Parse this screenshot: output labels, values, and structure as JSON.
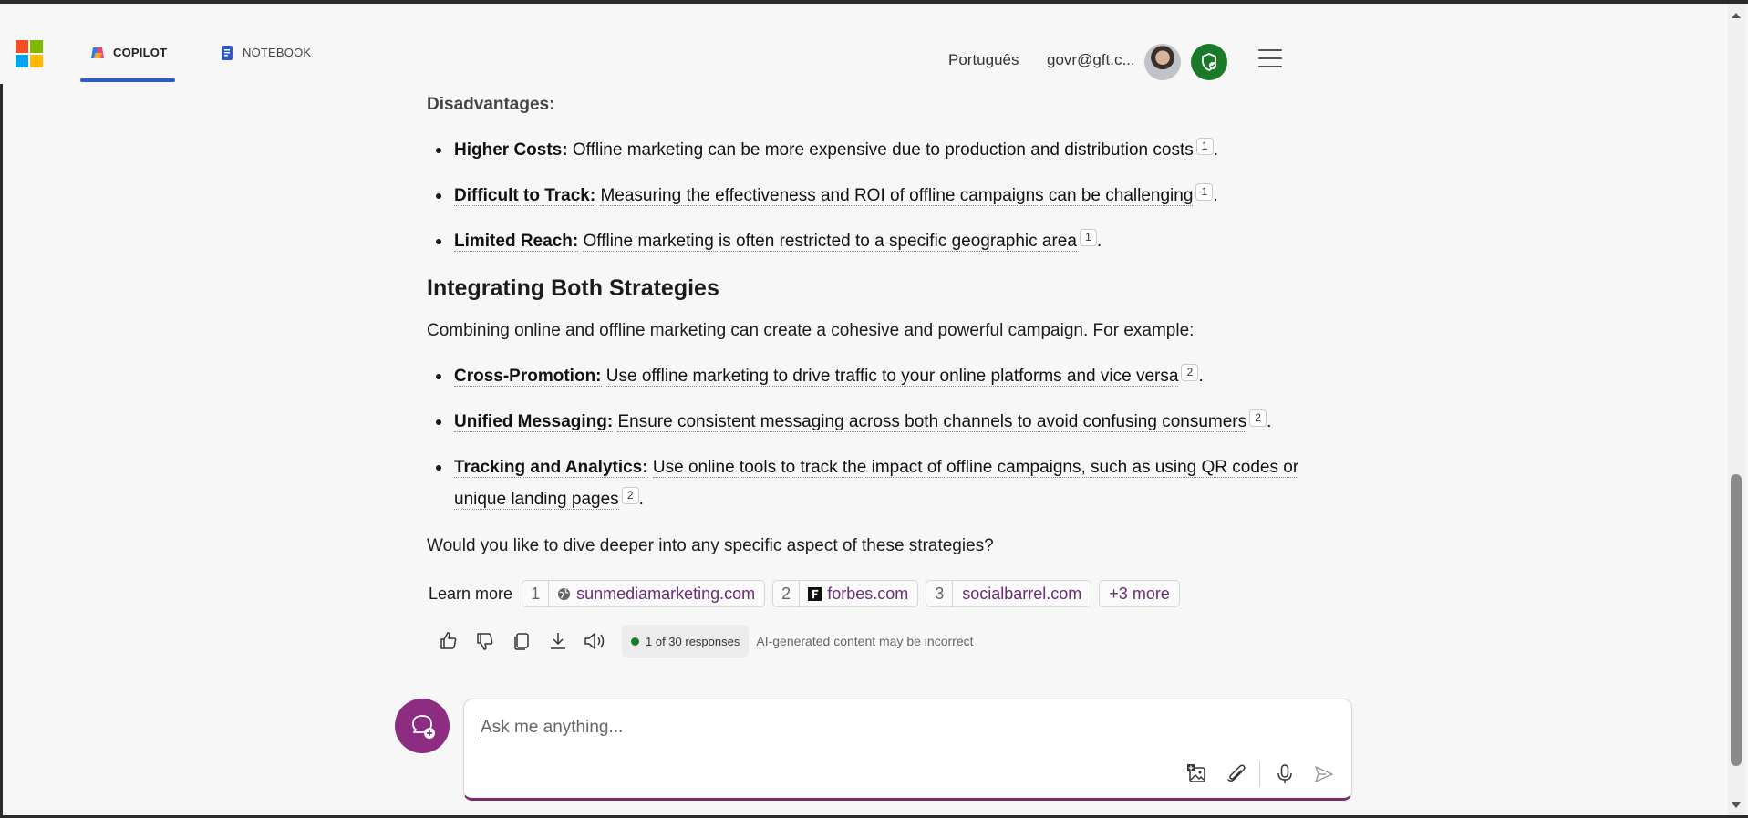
{
  "header": {
    "tabs": [
      {
        "label": "COPILOT",
        "active": true
      },
      {
        "label": "NOTEBOOK",
        "active": false
      }
    ],
    "language": "Português",
    "user": "govr@gft.c...",
    "colors": {
      "accent": "#2d59c9",
      "shield": "#1a7a29",
      "brand_purple": "#8c2d82"
    }
  },
  "content": {
    "disadvantages_heading": "Disadvantages:",
    "disadvantages": [
      {
        "title": "Higher Costs:",
        "text": "Offline marketing can be more expensive due to production and distribution costs",
        "cite": "1"
      },
      {
        "title": "Difficult to Track:",
        "text": "Measuring the effectiveness and ROI of offline campaigns can be challenging",
        "cite": "1"
      },
      {
        "title": "Limited Reach:",
        "text": "Offline marketing is often restricted to a specific geographic area",
        "cite": "1"
      }
    ],
    "integrating_heading": "Integrating Both Strategies",
    "integrating_intro": "Combining online and offline marketing can create a cohesive and powerful campaign. For example:",
    "integrating": [
      {
        "title": "Cross-Promotion:",
        "text": "Use offline marketing to drive traffic to your online platforms and vice versa",
        "cite": "2"
      },
      {
        "title": "Unified Messaging:",
        "text": "Ensure consistent messaging across both channels to avoid confusing consumers",
        "cite": "2"
      },
      {
        "title": "Tracking and Analytics:",
        "text": "Use online tools to track the impact of offline campaigns, such as using QR codes or",
        "text2": "unique landing pages",
        "cite": "2"
      }
    ],
    "closing": "Would you like to dive deeper into any specific aspect of these strategies?"
  },
  "learn_more": {
    "label": "Learn more",
    "sources": [
      {
        "num": "1",
        "site": "sunmediamarketing.com",
        "icon": "globe-icon"
      },
      {
        "num": "2",
        "site": "forbes.com",
        "icon": "forbes-icon"
      },
      {
        "num": "3",
        "site": "socialbarrel.com",
        "icon": "none"
      }
    ],
    "more": "+3 more"
  },
  "actions": {
    "icons": [
      "thumbs-up-icon",
      "thumbs-down-icon",
      "copy-icon",
      "download-icon",
      "speaker-icon"
    ],
    "responses": "1 of 30 responses",
    "note": "AI-generated content may be incorrect"
  },
  "input": {
    "placeholder": "Ask me anything...",
    "icons": [
      "add-image-icon",
      "attach-icon",
      "microphone-icon",
      "send-icon"
    ]
  }
}
